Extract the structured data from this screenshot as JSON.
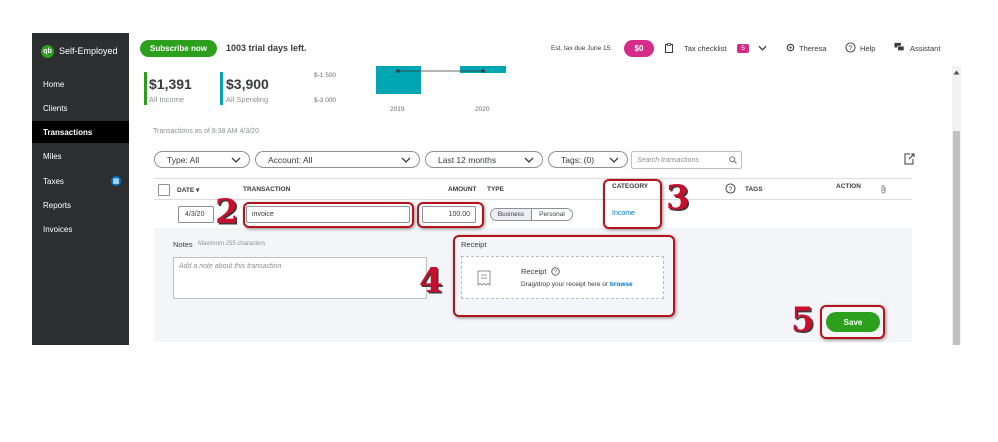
{
  "app": {
    "name": "Self-Employed",
    "logo_text": "qb"
  },
  "sidebar": {
    "items": [
      {
        "label": "Home"
      },
      {
        "label": "Clients"
      },
      {
        "label": "Transactions"
      },
      {
        "label": "Miles"
      },
      {
        "label": "Taxes"
      },
      {
        "label": "Reports"
      },
      {
        "label": "Invoices"
      }
    ],
    "active": "Transactions"
  },
  "topbar": {
    "subscribe_label": "Subscribe now",
    "trial_text": "1003 trial days left.",
    "est_tax_label": "Est. tax due June 15:",
    "est_tax_value": "$0",
    "tax_checklist_label": "Tax checklist",
    "tax_checklist_count": "5",
    "user_label": "Theresa",
    "help_label": "Help",
    "assistant_label": "Assistant"
  },
  "summary": {
    "income_amount": "$1,391",
    "income_label": "All Income",
    "spending_amount": "$3,900",
    "spending_label": "All Spending"
  },
  "mini_chart": {
    "y_labels": [
      "$-1 500",
      "$-3 000"
    ],
    "x_labels": [
      "2019",
      "2020"
    ]
  },
  "transactions": {
    "as_of": "Transactions as of 8:38 AM 4/3/20",
    "filters": {
      "type": "Type: All",
      "account": "Account: All",
      "period": "Last 12 months",
      "tags": "Tags: (0)"
    },
    "search_placeholder": "Search transactions",
    "headers": {
      "date": "DATE",
      "transaction": "TRANSACTION",
      "amount": "AMOUNT",
      "type": "TYPE",
      "category": "CATEGORY",
      "tags": "TAGS",
      "action": "ACTION"
    },
    "edit_row": {
      "date": "4/3/20",
      "transaction": "invoice",
      "amount": "100.00",
      "type_options": [
        "Business",
        "Personal"
      ],
      "type_selected": "Business",
      "category": "Income"
    },
    "notes": {
      "label": "Notes",
      "sublabel": "Maximum 255 characters",
      "placeholder": "Add a note about this transaction"
    },
    "receipt": {
      "section_label": "Receipt",
      "title": "Receipt",
      "hint_prefix": "Drag/drop your receipt here or",
      "browse_link": "browse"
    },
    "save_label": "Save"
  },
  "annotations": {
    "step2": "2",
    "step3": "3",
    "step4": "4",
    "step5": "5"
  },
  "colors": {
    "brand_green": "#2ca01c",
    "sidebar_bg": "#2d2e30",
    "tax_pink": "#d52b8b",
    "spending_teal": "#00a6b4",
    "link_blue": "#0077c5",
    "annotation_red": "#c8102e"
  }
}
